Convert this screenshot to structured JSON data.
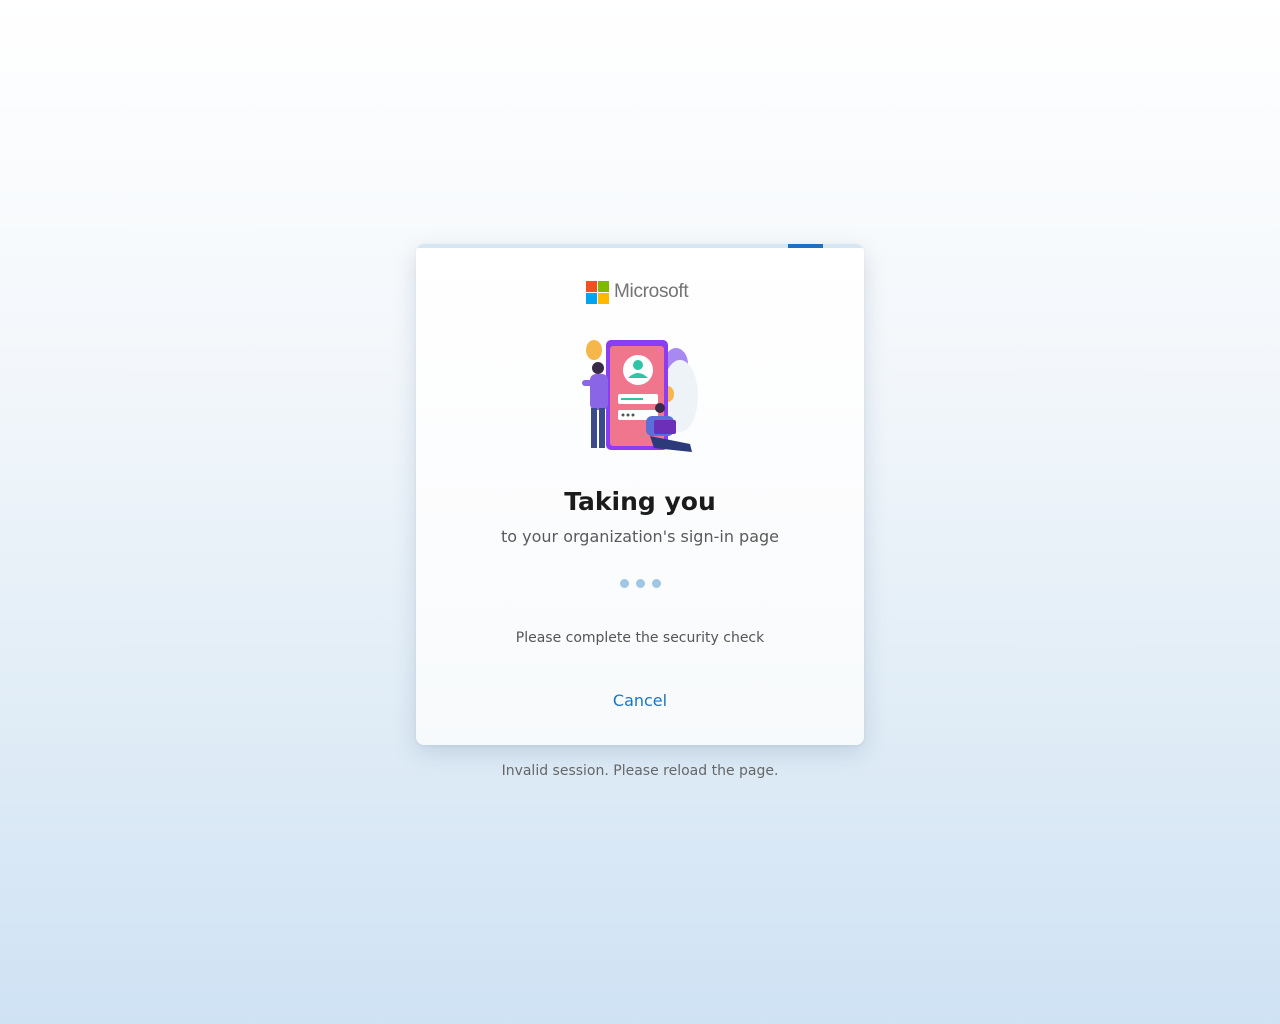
{
  "brand": {
    "name": "Microsoft",
    "colors": {
      "red": "#f25022",
      "green": "#7fba00",
      "blue": "#00a4ef",
      "yellow": "#ffb900"
    }
  },
  "progress": {
    "state": "indeterminate",
    "accent": "#1f6fc4"
  },
  "illustration": {
    "icon": "sign-in-illustration"
  },
  "card": {
    "title": "Taking you",
    "subtitle": "to your organization's sign-in page",
    "loading_indicator": "three-dots",
    "security_message": "Please complete the security check",
    "cancel_label": "Cancel"
  },
  "footer": {
    "message": "Invalid session. Please reload the page."
  }
}
